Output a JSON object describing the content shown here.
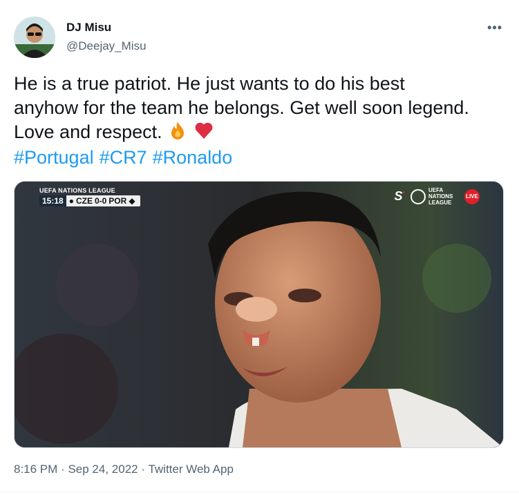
{
  "author": {
    "name": "DJ Misu",
    "handle": "@Deejay_Misu"
  },
  "tweet": {
    "text_line1": "He is a true patriot. He just wants to do his best",
    "text_line2": "anyhow for the team he belongs. Get well soon legend.",
    "text_line3": "Love and respect.",
    "emojis": [
      "fire-icon",
      "red-heart-icon"
    ],
    "hashtags": [
      "#Portugal",
      "#CR7",
      "#Ronaldo"
    ]
  },
  "media": {
    "competition": "UEFA NATIONS LEAGUE",
    "clock": "15:18",
    "home_team": "CZE",
    "score": "0-0",
    "away_team": "POR",
    "channel": "S",
    "uefa_logo_text": "UEFA NATIONS LEAGUE",
    "live_label": "LIVE"
  },
  "footer": {
    "time": "8:16 PM",
    "date": "Sep 24, 2022",
    "source": "Twitter Web App",
    "separator": "·"
  },
  "colors": {
    "accent": "#1d9bf0",
    "secondary_text": "#536471",
    "primary_text": "#0f1419"
  }
}
